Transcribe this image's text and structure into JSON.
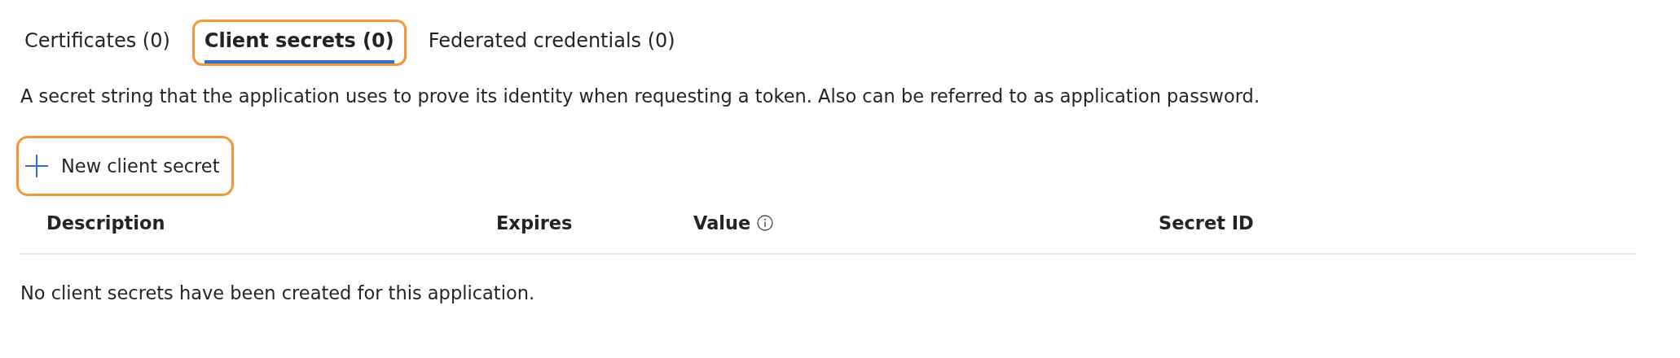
{
  "tabs": [
    {
      "label": "Certificates (0)",
      "selected": false,
      "highlighted": false
    },
    {
      "label": "Client secrets (0)",
      "selected": true,
      "highlighted": true
    },
    {
      "label": "Federated credentials (0)",
      "selected": false,
      "highlighted": false
    }
  ],
  "description": "A secret string that the application uses to prove its identity when requesting a token. Also can be referred to as application password.",
  "new_button": {
    "label": "New client secret",
    "highlighted": true
  },
  "table": {
    "columns": [
      {
        "label": "Description",
        "info": false
      },
      {
        "label": "Expires",
        "info": false
      },
      {
        "label": "Value",
        "info": true
      },
      {
        "label": "Secret ID",
        "info": false
      }
    ],
    "empty_message": "No client secrets have been created for this application."
  }
}
